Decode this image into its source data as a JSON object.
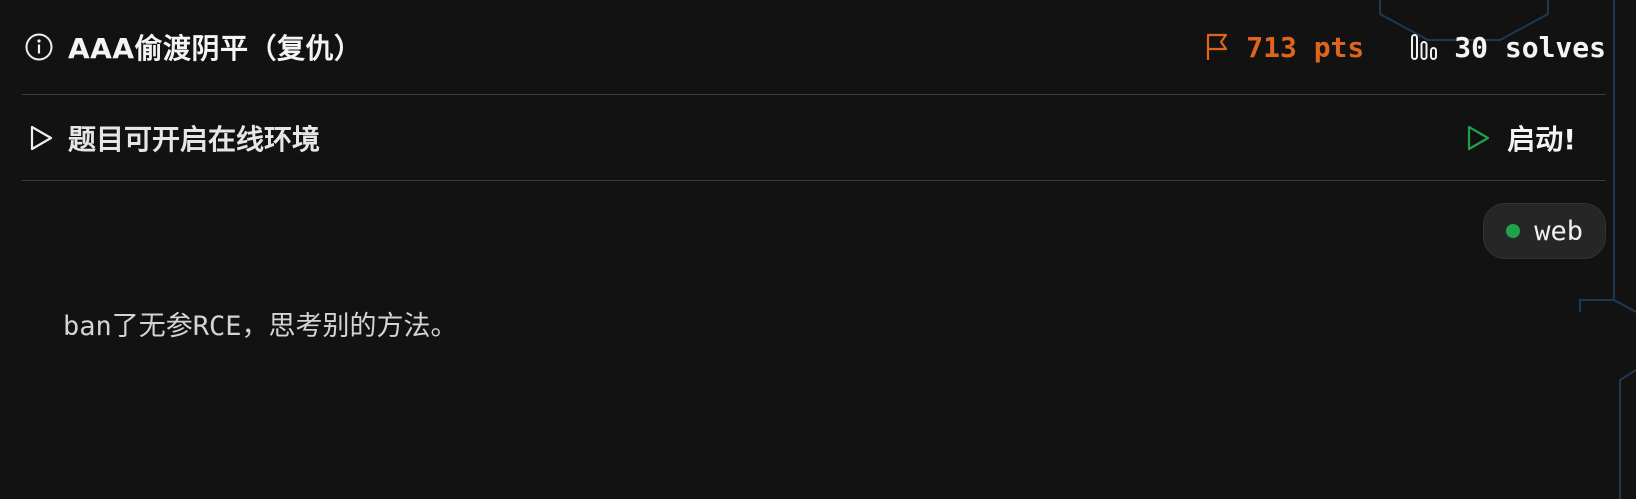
{
  "header": {
    "title": "AAA偷渡阴平（复仇）",
    "points": "713 pts",
    "solves": "30 solves"
  },
  "environment": {
    "label": "题目可开启在线环境",
    "launch_label": "启动!"
  },
  "tag": {
    "label": "web"
  },
  "description": "ban了无参RCE，思考别的方法。",
  "colors": {
    "background": "#121212",
    "accent_points": "#e0651c",
    "launch_icon": "#1fa24a",
    "tag_dot": "#1fa24a",
    "divider": "#3a3a3a",
    "hex_lines": "#1d3a55"
  }
}
